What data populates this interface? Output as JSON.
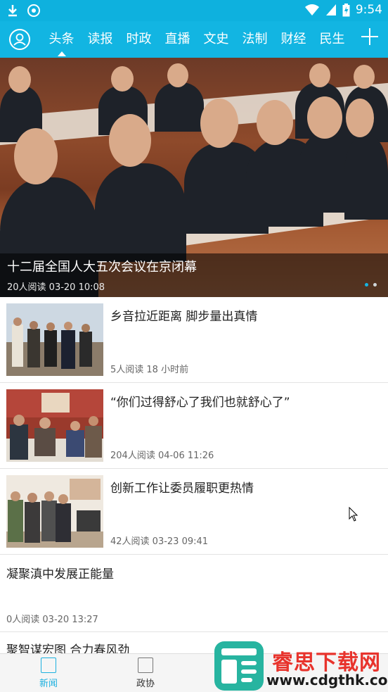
{
  "status_bar": {
    "time": "9:54"
  },
  "nav": {
    "tabs": [
      "头条",
      "读报",
      "时政",
      "直播",
      "文史",
      "法制",
      "财经",
      "民生"
    ],
    "active_tab": 0
  },
  "hero": {
    "title": "十二届全国人大五次会议在京闭幕",
    "meta": "20人阅读  03-20 10:08",
    "dot_count": 2,
    "active_dot": 0
  },
  "news": [
    {
      "title": "乡音拉近距离 脚步量出真情",
      "meta": "5人阅读   18 小时前"
    },
    {
      "title": "“你们过得舒心了我们也就舒心了”",
      "meta": "204人阅读   04-06 11:26"
    },
    {
      "title": "创新工作让委员履职更热情",
      "meta": "42人阅读   03-23 09:41"
    },
    {
      "title": "凝聚滇中发展正能量",
      "meta": "0人阅读   03-20 13:27"
    },
    {
      "title": "聚智谋宏图 合力春风劲",
      "meta": ""
    }
  ],
  "bottom_nav": [
    {
      "label": "新闻",
      "active": true
    },
    {
      "label": "政协",
      "active": false
    },
    {
      "label": "",
      "active": false
    },
    {
      "label": "",
      "active": false
    }
  ],
  "watermark": {
    "name": "睿思下载网",
    "url": "www.cdgthk.com"
  },
  "colors": {
    "accent": "#12b5e2",
    "status": "#0eb1de"
  }
}
